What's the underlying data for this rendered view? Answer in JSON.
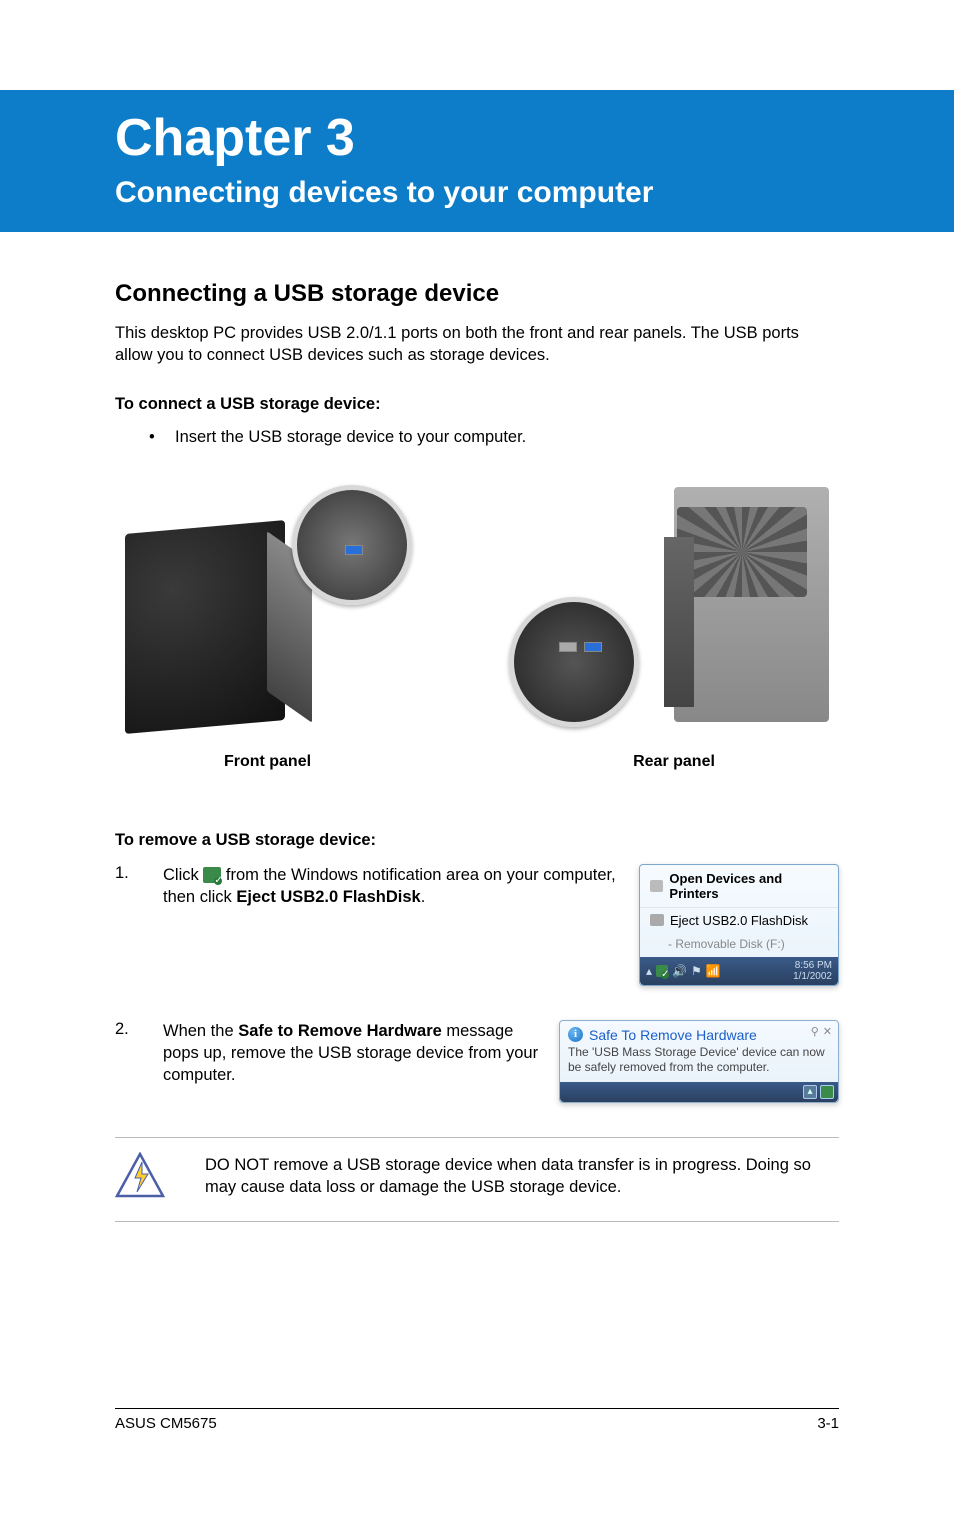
{
  "header": {
    "chapter": "Chapter 3",
    "subtitle": "Connecting devices to your computer"
  },
  "section1": {
    "heading": "Connecting a USB storage device",
    "intro": "This desktop PC provides USB 2.0/1.1 ports on both the front and rear panels. The USB ports allow you to connect USB devices such as storage devices.",
    "connect_heading": "To connect a USB storage device:",
    "bullet": "Insert the USB storage device to your computer.",
    "front_caption": "Front panel",
    "rear_caption": "Rear panel"
  },
  "remove": {
    "heading": "To remove a USB storage device:",
    "step1_num": "1.",
    "step1_a": "Click ",
    "step1_b": " from the Windows notification area on your computer, then click ",
    "step1_bold": "Eject USB2.0 FlashDisk",
    "step1_c": ".",
    "step2_num": "2.",
    "step2_a": "When the ",
    "step2_bold": "Safe to Remove Hardware",
    "step2_b": " message pops up, remove the USB storage device from your computer."
  },
  "win_menu": {
    "head": "Open Devices and Printers",
    "item": "Eject USB2.0 FlashDisk",
    "sub": "- Removable Disk (F:)",
    "time": "8:56 PM",
    "date": "1/1/2002"
  },
  "balloon": {
    "title": "Safe To Remove Hardware",
    "body": "The 'USB Mass Storage Device' device can now be safely removed from the computer."
  },
  "warning": "DO NOT remove a USB storage device when data transfer is in progress. Doing so may cause data loss or damage the USB storage device.",
  "footer": {
    "left": "ASUS CM5675",
    "right": "3-1"
  }
}
